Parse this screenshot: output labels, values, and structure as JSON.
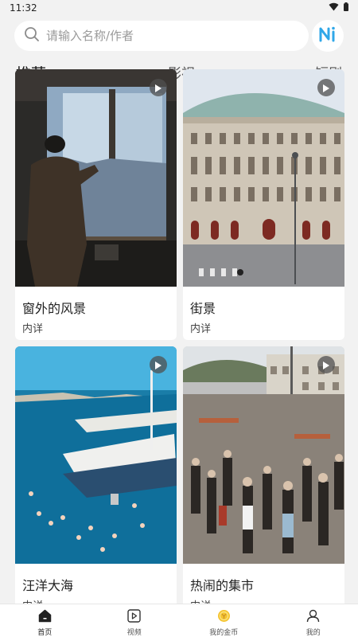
{
  "status_bar": {
    "time": "11:32"
  },
  "search": {
    "placeholder": "请输入名称/作者",
    "value": ""
  },
  "tabs": [
    {
      "label": "推荐",
      "active": true
    },
    {
      "label": "影视",
      "active": false
    },
    {
      "label": "短剧",
      "active": false
    }
  ],
  "cards": [
    {
      "title": "窗外的风景",
      "subtitle": "内详"
    },
    {
      "title": "街景",
      "subtitle": "内详"
    },
    {
      "title": "汪洋大海",
      "subtitle": "内详"
    },
    {
      "title": "热闹的集市",
      "subtitle": "内详"
    }
  ],
  "bottom_nav": [
    {
      "label": "首页",
      "icon": "home-icon",
      "active": true
    },
    {
      "label": "视频",
      "icon": "video-icon",
      "active": false
    },
    {
      "label": "我的金币",
      "icon": "coin-icon",
      "active": false
    },
    {
      "label": "我的",
      "icon": "user-icon",
      "active": false
    }
  ],
  "colors": {
    "accent": "#2fa7e8",
    "coin": "#f5c431",
    "background": "#f2f2f2"
  }
}
